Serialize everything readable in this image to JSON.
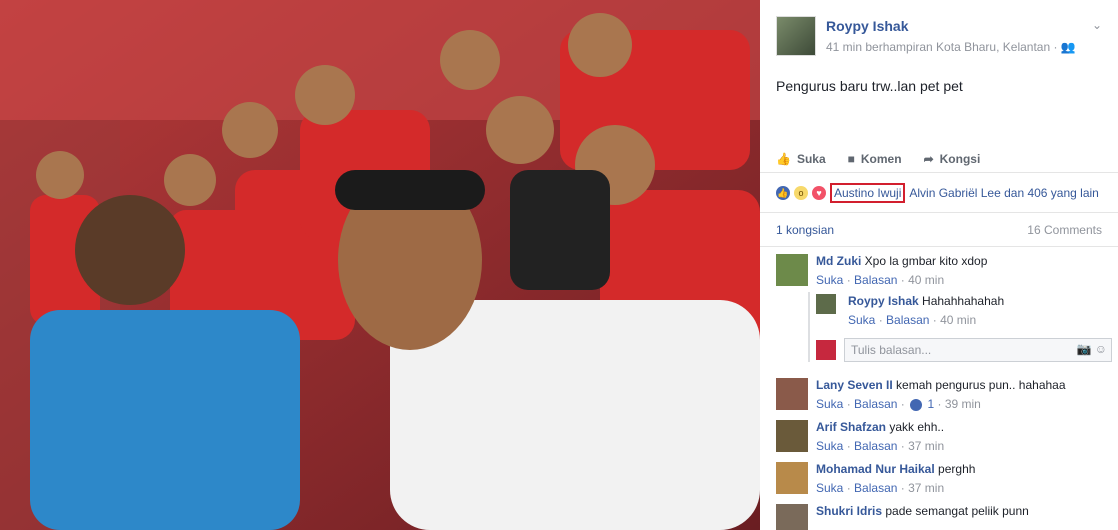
{
  "post": {
    "author": "Roypy Ishak",
    "meta": "41 min berhampiran Kota Bharu, Kelantan ·",
    "text": "Pengurus baru trw..lan pet pet",
    "actions": {
      "like": "Suka",
      "comment": "Komen",
      "share": "Kongsi"
    },
    "reactions": {
      "boxed_name": "Austino Iwuji",
      "rest": "Alvin Gabriël Lee dan 406 yang lain"
    },
    "shares": "1 kongsian",
    "comments_count": "16 Comments",
    "reply_placeholder": "Tulis balasan..."
  },
  "comments": [
    {
      "name": "Md Zuki",
      "text": "Xpo la gmbar kito xdop",
      "like": "Suka",
      "reply": "Balasan",
      "time": "40 min"
    },
    {
      "name": "Roypy Ishak",
      "text": "Hahahhahahah",
      "like": "Suka",
      "reply": "Balasan",
      "time": "40 min"
    },
    {
      "name": "Lany Seven II",
      "text": "kemah pengurus pun.. hahahaa",
      "like": "Suka",
      "reply": "Balasan",
      "likes": "1",
      "time": "39 min"
    },
    {
      "name": "Arif Shafzan",
      "text": "yakk ehh..",
      "like": "Suka",
      "reply": "Balasan",
      "time": "37 min"
    },
    {
      "name": "Mohamad Nur Haikal",
      "text": "perghh",
      "like": "Suka",
      "reply": "Balasan",
      "time": "37 min"
    },
    {
      "name": "Shukri Idris",
      "text": "pade semangat peliik punn"
    }
  ],
  "separators": {
    "dot": "·"
  },
  "icons": {
    "like": "thumb-up-icon",
    "comment": "speech-bubble-icon",
    "share": "share-arrow-icon",
    "audience": "friends-icon",
    "chevron": "chevron-down-icon",
    "camera": "camera-icon",
    "emoji": "smiley-icon"
  },
  "colors": {
    "link": "#365899",
    "highlight": "#d21f2e",
    "muted": "#90949c"
  }
}
